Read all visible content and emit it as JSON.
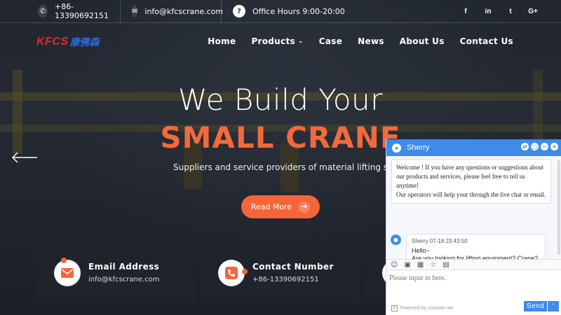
{
  "topbar": {
    "phone": "+86-13390692151",
    "email": "info@kfcscrane.com",
    "hours": "Office Hours 9:00-20:00",
    "social": [
      "f",
      "in",
      "t",
      "G+"
    ]
  },
  "logo": {
    "brand": "KFCS",
    "chinese": "康佛森"
  },
  "nav": {
    "items": [
      "Home",
      "Products",
      "Case",
      "News",
      "About Us",
      "Contact Us"
    ]
  },
  "hero": {
    "title_line1": "We Build Your",
    "title_line2": "SMALL CRANE",
    "subtitle": "Suppliers and service providers of material lifting system",
    "cta_label": "Read More"
  },
  "cards": [
    {
      "title": "Email Address",
      "text": "info@kfcscrane.com"
    },
    {
      "title": "Contact Number",
      "text": "+86-13390692151"
    }
  ],
  "chat": {
    "agent_name": "Sherry",
    "welcome": "Welcome ! If you have any questions or suggestions about our products and services, please feel free to tell us anytime!",
    "welcome_2": "Our operators will help your through the live chat or email.",
    "message_meta": "Sherry  07-18 23:43:50",
    "message_line1": "Hello~",
    "message_line2": "Are you looking for lifting equipment? Crane? Hoist? or Wheel blocks?",
    "input_placeholder": "Please input in here.",
    "powered_by": "Powered by zoosnet.net",
    "send_label": "Send"
  },
  "colors": {
    "accent": "#f4663a",
    "chat_blue": "#3e8be8",
    "brand_red": "#e02c2c",
    "brand_blue": "#2d6ce0"
  },
  "icons": {
    "phone": "phone-icon",
    "email": "envelope-icon",
    "hours": "question-icon"
  }
}
